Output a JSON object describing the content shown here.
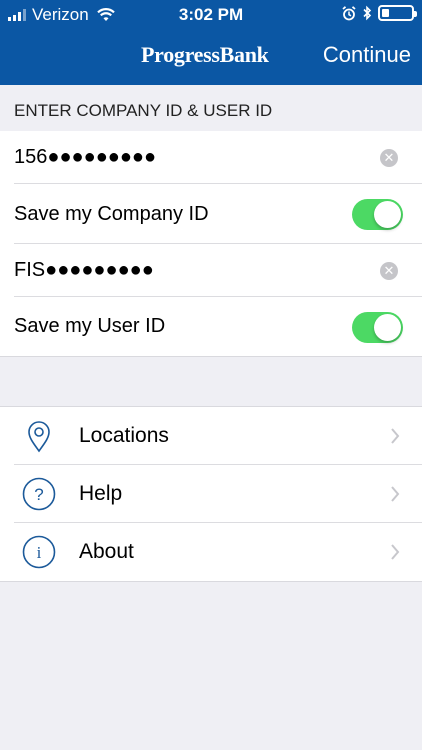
{
  "status_bar": {
    "carrier": "Verizon",
    "time": "3:02 PM",
    "battery_level": 0.25
  },
  "nav": {
    "logo": "ProgressBank",
    "continue_label": "Continue"
  },
  "form": {
    "section_title": "ENTER COMPANY ID & USER ID",
    "company_id_value": "156●●●●●●●●●",
    "save_company_label": "Save my Company ID",
    "save_company_on": true,
    "user_id_value": "FIS●●●●●●●●●",
    "save_user_label": "Save my User ID",
    "save_user_on": true
  },
  "menu": {
    "items": [
      {
        "label": "Locations",
        "icon": "location-pin-icon"
      },
      {
        "label": "Help",
        "icon": "question-icon"
      },
      {
        "label": "About",
        "icon": "info-icon"
      }
    ]
  },
  "colors": {
    "brand": "#0b57a4",
    "toggle_on": "#4cd964",
    "background": "#efeff4",
    "icon_blue": "#1c5a9a"
  }
}
